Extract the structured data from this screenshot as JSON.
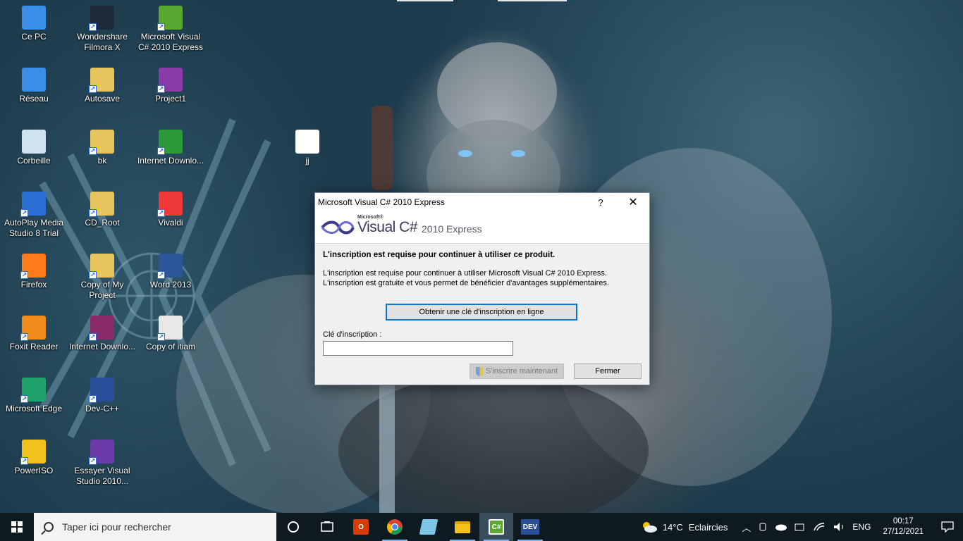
{
  "desktop": {
    "icons": [
      {
        "label": "Ce PC",
        "icon": "computer-icon",
        "color": "#3a8ee6"
      },
      {
        "label": "Wondershare Filmora X",
        "icon": "filmora-icon",
        "color": "#1d2b3a"
      },
      {
        "label": "Microsoft Visual C# 2010 Express",
        "icon": "visual-csharp-icon",
        "color": "#5aa832"
      },
      {
        "label": "Réseau",
        "icon": "network-icon",
        "color": "#3a8ee6"
      },
      {
        "label": "Autosave",
        "icon": "folder-icon",
        "color": "#e8c45c"
      },
      {
        "label": "Project1",
        "icon": "dev-file-icon",
        "color": "#8b3ba8"
      },
      {
        "label": "Corbeille",
        "icon": "recycle-bin-icon",
        "color": "#cfe3ef"
      },
      {
        "label": "bk",
        "icon": "folder-icon",
        "color": "#e8c45c"
      },
      {
        "label": "Internet Downlo...",
        "icon": "internet-download-icon",
        "color": "#2d9a3a"
      },
      {
        "label": "AutoPlay Media Studio 8 Trial",
        "icon": "autoplay-icon",
        "color": "#2a6fd4"
      },
      {
        "label": "CD_Root",
        "icon": "folder-icon",
        "color": "#e8c45c"
      },
      {
        "label": "Vivaldi",
        "icon": "vivaldi-icon",
        "color": "#ef3939"
      },
      {
        "label": "Firefox",
        "icon": "firefox-icon",
        "color": "#ff7a1a"
      },
      {
        "label": "Copy of My Project",
        "icon": "folder-icon",
        "color": "#e8c45c"
      },
      {
        "label": "Word 2013",
        "icon": "word-icon",
        "color": "#2b579a"
      },
      {
        "label": "Foxit Reader",
        "icon": "foxit-icon",
        "color": "#f28b1d"
      },
      {
        "label": "Internet Downlo...",
        "icon": "winrar-icon",
        "color": "#8a2a6a"
      },
      {
        "label": "Copy of itiam",
        "icon": "disc-image-icon",
        "color": "#e8e8e8"
      },
      {
        "label": "Microsoft Edge",
        "icon": "edge-icon",
        "color": "#1fa36a"
      },
      {
        "label": "Dev-C++",
        "icon": "devcpp-icon",
        "color": "#2a4f9a"
      },
      {
        "label": "PowerISO",
        "icon": "poweriso-icon",
        "color": "#f2c21d"
      },
      {
        "label": "Essayer Visual Studio 2010...",
        "icon": "visual-studio-icon",
        "color": "#6a3aa8"
      },
      {
        "label": "jj",
        "icon": "text-file-icon",
        "color": "#ffffff"
      }
    ]
  },
  "dialog": {
    "title": "Microsoft Visual C# 2010 Express",
    "help": "?",
    "close": "✕",
    "logo": {
      "ms": "Microsoft®",
      "product": "Visual C#",
      "edition": "2010 Express"
    },
    "heading": "L'inscription est requise pour continuer à utiliser ce produit.",
    "line1": "L'inscription est requise pour continuer à utiliser Microsoft Visual C# 2010 Express.",
    "line2": "L'inscription est gratuite et vous permet de bénéficier d'avantages supplémentaires.",
    "online_key_button": "Obtenir une clé d'inscription en ligne",
    "key_label": "Clé d'inscription :",
    "key_value": "",
    "register_button": "S'inscrire maintenant",
    "close_button": "Fermer"
  },
  "taskbar": {
    "search_placeholder": "Taper ici pour rechercher",
    "apps": [
      {
        "name": "cortana",
        "icon": "cortana-icon"
      },
      {
        "name": "task-view",
        "icon": "task-view-icon"
      },
      {
        "name": "office",
        "icon": "office-icon",
        "color": "#d83b01"
      },
      {
        "name": "chrome",
        "icon": "chrome-icon",
        "color": "#4caf50"
      },
      {
        "name": "notepad",
        "icon": "notepad-icon",
        "color": "#7fc7e8"
      },
      {
        "name": "file-explorer",
        "icon": "file-explorer-icon",
        "color": "#f2c21d"
      },
      {
        "name": "visual-csharp",
        "icon": "visual-csharp-icon",
        "color": "#5aa832"
      },
      {
        "name": "dev-cpp",
        "icon": "devcpp-icon",
        "color": "#2a4f9a"
      }
    ],
    "weather_temp": "14°C",
    "weather_text": "Eclaircies",
    "language": "ENG",
    "time": "00:17",
    "date": "27/12/2021"
  }
}
